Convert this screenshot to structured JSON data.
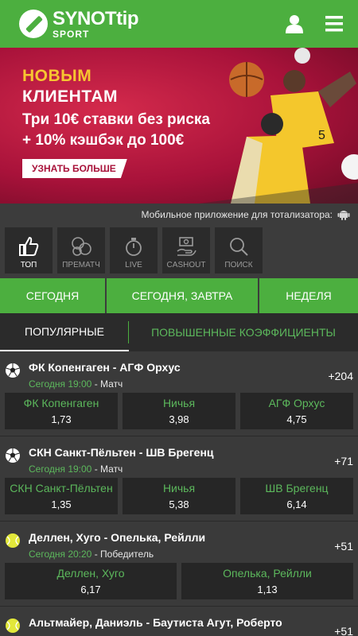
{
  "brand": {
    "name": "SYNOTtip",
    "sub": "SPORT"
  },
  "icons": {
    "user": "user-icon",
    "menu": "hamburger-menu-icon",
    "android": "android-icon"
  },
  "colors": {
    "accent": "#4caf3f",
    "odds_label": "#5cb85c",
    "banner_bg": "#a8123a",
    "banner_highlight": "#f7c531"
  },
  "banner": {
    "line1": "НОВЫМ",
    "line2": "КЛИЕНТАМ",
    "line3": "Три 10€ ставки без риска",
    "line4": "+ 10% кэшбэк до 100€",
    "button": "УЗНАТЬ БОЛЬШЕ"
  },
  "app_bar": {
    "text": "Мобильное приложение для тотализатора:"
  },
  "tiles": [
    {
      "label": "ТОП",
      "icon": "thumbs-up-icon",
      "active": true
    },
    {
      "label": "ПРЕМАТЧ",
      "icon": "balls-icon",
      "active": false
    },
    {
      "label": "LIVE",
      "icon": "stopwatch-icon",
      "active": false
    },
    {
      "label": "CASHOUT",
      "icon": "cashout-icon",
      "active": false
    },
    {
      "label": "ПОИСК",
      "icon": "search-icon",
      "active": false
    }
  ],
  "period_tabs": [
    "СЕГОДНЯ",
    "СЕГОДНЯ, ЗАВТРА",
    "НЕДЕЛЯ"
  ],
  "section_tabs": {
    "popular": "ПОПУЛЯРНЫЕ",
    "boosted": "ПОВЫШЕННЫЕ КОЭФФИЦИЕНТЫ"
  },
  "events": [
    {
      "sport": "football-icon",
      "title": "ФК Копенгаген - АГФ Орхус",
      "time": "Сегодня 19:00",
      "market": " - Матч",
      "count": "+204",
      "odds": [
        {
          "label": "ФК Копенгаген",
          "value": "1,73"
        },
        {
          "label": "Ничья",
          "value": "3,98"
        },
        {
          "label": "АГФ Орхус",
          "value": "4,75"
        }
      ]
    },
    {
      "sport": "football-icon",
      "title": "СКН Санкт-Пёльтен - ШВ Брегенц",
      "time": "Сегодня 19:00",
      "market": " - Матч",
      "count": "+71",
      "odds": [
        {
          "label": "СКН Санкт-Пёльтен",
          "value": "1,35"
        },
        {
          "label": "Ничья",
          "value": "5,38"
        },
        {
          "label": "ШВ Брегенц",
          "value": "6,14"
        }
      ]
    },
    {
      "sport": "tennis-icon",
      "title": "Деллен, Хуго - Опелька, Рейлли",
      "time": "Сегодня 20:20",
      "market": " - Победитель",
      "count": "+51",
      "odds": [
        {
          "label": "Деллен, Хуго",
          "value": "6,17"
        },
        {
          "label": "Опелька, Рейлли",
          "value": "1,13"
        }
      ]
    },
    {
      "sport": "tennis-icon",
      "title": "Альтмайер, Даниэль - Баутиста Агут, Роберто",
      "count": "+51"
    }
  ]
}
